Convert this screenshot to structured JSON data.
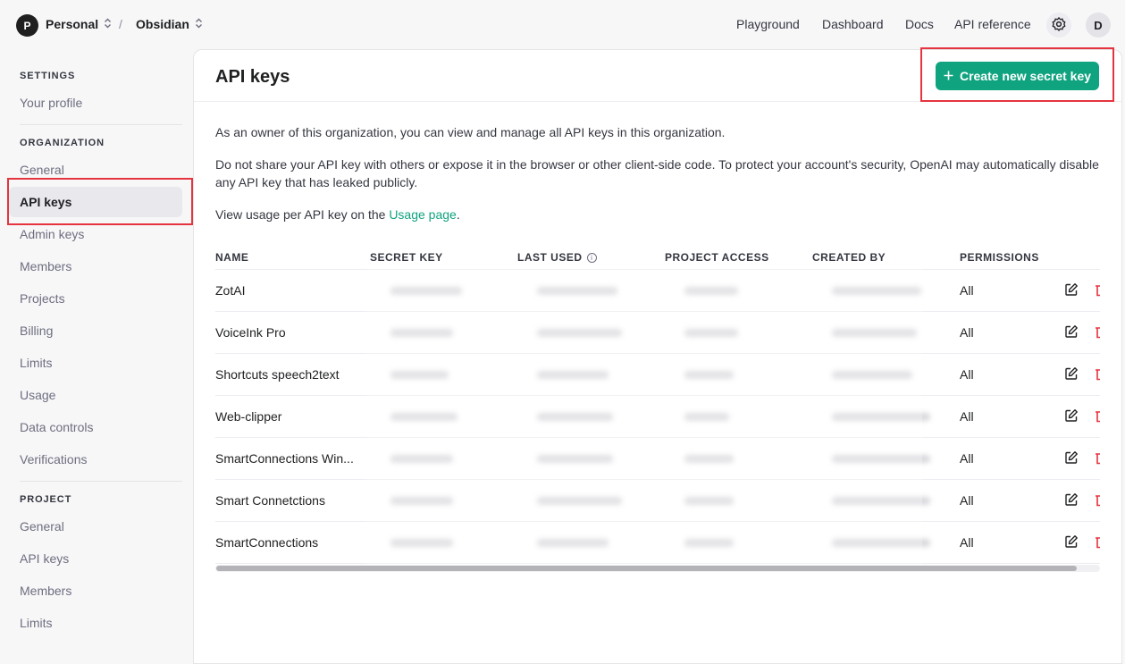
{
  "topbar": {
    "org_initial": "P",
    "org_name": "Personal",
    "project_name": "Obsidian",
    "separator": "/",
    "nav": [
      "Playground",
      "Dashboard",
      "Docs",
      "API reference"
    ],
    "user_initial": "D"
  },
  "sidebar": {
    "settings_heading": "SETTINGS",
    "settings_items": [
      "Your profile"
    ],
    "organization_heading": "ORGANIZATION",
    "organization_items": [
      "General",
      "API keys",
      "Admin keys",
      "Members",
      "Projects",
      "Billing",
      "Limits",
      "Usage",
      "Data controls",
      "Verifications"
    ],
    "active_item": "API keys",
    "project_heading": "PROJECT",
    "project_items": [
      "General",
      "API keys",
      "Members",
      "Limits"
    ]
  },
  "main": {
    "title": "API keys",
    "create_button": "Create new secret key",
    "intro": "As an owner of this organization, you can view and manage all API keys in this organization.",
    "warning": "Do not share your API key with others or expose it in the browser or other client-side code. To protect your account's security, OpenAI may automatically disable any API key that has leaked publicly.",
    "usage_prefix": "View usage per API key on the ",
    "usage_link": "Usage page",
    "usage_suffix": ".",
    "table": {
      "headers": [
        "NAME",
        "SECRET KEY",
        "LAST USED",
        "PROJECT ACCESS",
        "CREATED BY",
        "PERMISSIONS"
      ],
      "rows": [
        {
          "name": "ZotAI",
          "permissions": "All"
        },
        {
          "name": "VoiceInk Pro",
          "permissions": "All"
        },
        {
          "name": "Shortcuts speech2text",
          "permissions": "All"
        },
        {
          "name": "Web-clipper",
          "permissions": "All"
        },
        {
          "name": "SmartConnections Win...",
          "permissions": "All"
        },
        {
          "name": "Smart Connetctions",
          "permissions": "All"
        },
        {
          "name": "SmartConnections",
          "permissions": "All"
        }
      ]
    }
  },
  "colors": {
    "accent": "#10a37f",
    "highlight": "#e5343f",
    "delete": "#e5343f"
  }
}
